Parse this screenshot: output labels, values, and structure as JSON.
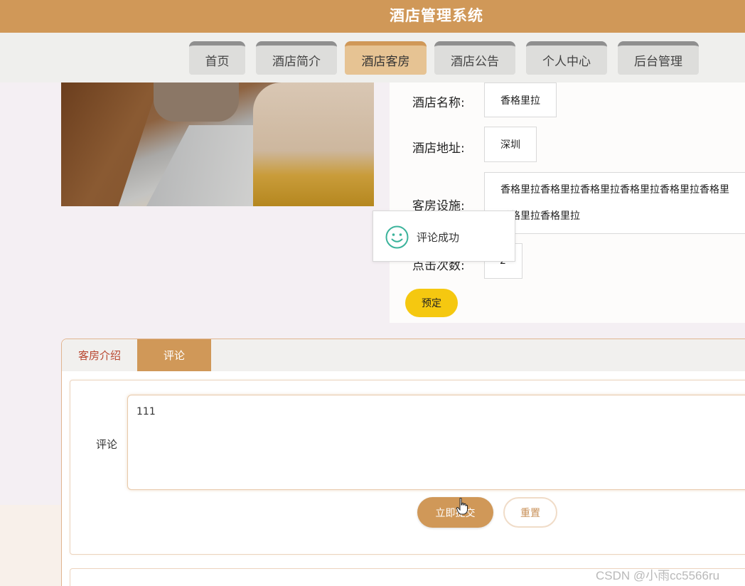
{
  "header": {
    "title": "酒店管理系统"
  },
  "nav": {
    "items": [
      {
        "label": "首页",
        "active": false
      },
      {
        "label": "酒店简介",
        "active": false
      },
      {
        "label": "酒店客房",
        "active": true
      },
      {
        "label": "酒店公告",
        "active": false
      },
      {
        "label": "个人中心",
        "active": false
      },
      {
        "label": "后台管理",
        "active": false
      }
    ]
  },
  "room": {
    "fields": [
      {
        "label": "酒店名称:",
        "value": "香格里拉"
      },
      {
        "label": "酒店地址:",
        "value": "深圳"
      },
      {
        "label": "客房设施:",
        "value_line1": "香格里拉香格里拉香格里拉香格里拉香格里拉香格里",
        "value_line2": "香格里拉香格里拉"
      },
      {
        "label": "点击次数:",
        "value": "2"
      }
    ],
    "book_label": "预定"
  },
  "toast": {
    "message": "评论成功",
    "icon": "smiley-icon"
  },
  "tabs": [
    {
      "label": "客房介绍",
      "active": false
    },
    {
      "label": "评论",
      "active": true
    }
  ],
  "comment_form": {
    "label": "评论",
    "value": "111",
    "submit_label": "立即提交",
    "reset_label": "重置"
  },
  "watermark": "CSDN @小雨cc5566ru",
  "colors": {
    "primary": "#d09858",
    "accent_yellow": "#f5c810",
    "tab_inactive_text": "#b8452e",
    "toast_icon": "#3bb39b"
  }
}
